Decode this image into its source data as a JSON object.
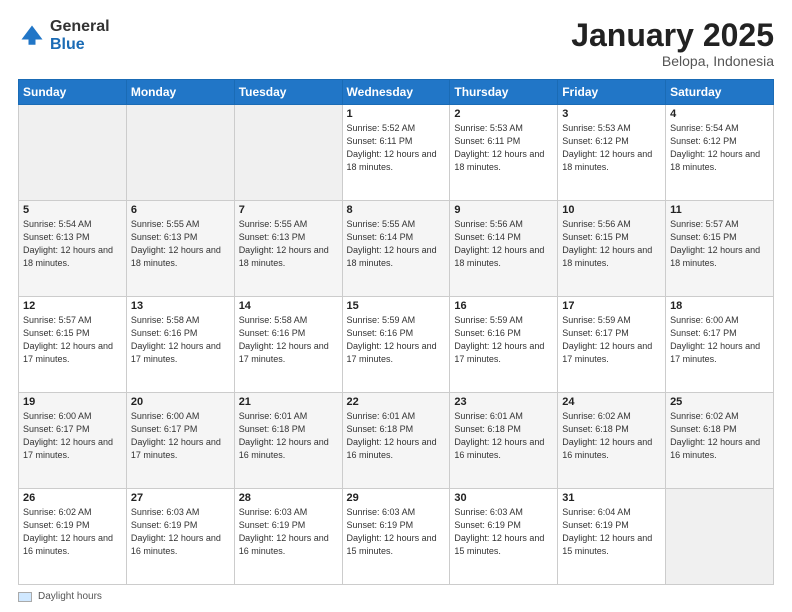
{
  "logo": {
    "general": "General",
    "blue": "Blue"
  },
  "title": "January 2025",
  "location": "Belopa, Indonesia",
  "days_header": [
    "Sunday",
    "Monday",
    "Tuesday",
    "Wednesday",
    "Thursday",
    "Friday",
    "Saturday"
  ],
  "footer_label": "Daylight hours",
  "weeks": [
    {
      "cells": [
        {
          "day": null,
          "info": null
        },
        {
          "day": null,
          "info": null
        },
        {
          "day": null,
          "info": null
        },
        {
          "day": "1",
          "info": "Sunrise: 5:52 AM\nSunset: 6:11 PM\nDaylight: 12 hours\nand 18 minutes."
        },
        {
          "day": "2",
          "info": "Sunrise: 5:53 AM\nSunset: 6:11 PM\nDaylight: 12 hours\nand 18 minutes."
        },
        {
          "day": "3",
          "info": "Sunrise: 5:53 AM\nSunset: 6:12 PM\nDaylight: 12 hours\nand 18 minutes."
        },
        {
          "day": "4",
          "info": "Sunrise: 5:54 AM\nSunset: 6:12 PM\nDaylight: 12 hours\nand 18 minutes."
        }
      ]
    },
    {
      "cells": [
        {
          "day": "5",
          "info": "Sunrise: 5:54 AM\nSunset: 6:13 PM\nDaylight: 12 hours\nand 18 minutes."
        },
        {
          "day": "6",
          "info": "Sunrise: 5:55 AM\nSunset: 6:13 PM\nDaylight: 12 hours\nand 18 minutes."
        },
        {
          "day": "7",
          "info": "Sunrise: 5:55 AM\nSunset: 6:13 PM\nDaylight: 12 hours\nand 18 minutes."
        },
        {
          "day": "8",
          "info": "Sunrise: 5:55 AM\nSunset: 6:14 PM\nDaylight: 12 hours\nand 18 minutes."
        },
        {
          "day": "9",
          "info": "Sunrise: 5:56 AM\nSunset: 6:14 PM\nDaylight: 12 hours\nand 18 minutes."
        },
        {
          "day": "10",
          "info": "Sunrise: 5:56 AM\nSunset: 6:15 PM\nDaylight: 12 hours\nand 18 minutes."
        },
        {
          "day": "11",
          "info": "Sunrise: 5:57 AM\nSunset: 6:15 PM\nDaylight: 12 hours\nand 18 minutes."
        }
      ]
    },
    {
      "cells": [
        {
          "day": "12",
          "info": "Sunrise: 5:57 AM\nSunset: 6:15 PM\nDaylight: 12 hours\nand 17 minutes."
        },
        {
          "day": "13",
          "info": "Sunrise: 5:58 AM\nSunset: 6:16 PM\nDaylight: 12 hours\nand 17 minutes."
        },
        {
          "day": "14",
          "info": "Sunrise: 5:58 AM\nSunset: 6:16 PM\nDaylight: 12 hours\nand 17 minutes."
        },
        {
          "day": "15",
          "info": "Sunrise: 5:59 AM\nSunset: 6:16 PM\nDaylight: 12 hours\nand 17 minutes."
        },
        {
          "day": "16",
          "info": "Sunrise: 5:59 AM\nSunset: 6:16 PM\nDaylight: 12 hours\nand 17 minutes."
        },
        {
          "day": "17",
          "info": "Sunrise: 5:59 AM\nSunset: 6:17 PM\nDaylight: 12 hours\nand 17 minutes."
        },
        {
          "day": "18",
          "info": "Sunrise: 6:00 AM\nSunset: 6:17 PM\nDaylight: 12 hours\nand 17 minutes."
        }
      ]
    },
    {
      "cells": [
        {
          "day": "19",
          "info": "Sunrise: 6:00 AM\nSunset: 6:17 PM\nDaylight: 12 hours\nand 17 minutes."
        },
        {
          "day": "20",
          "info": "Sunrise: 6:00 AM\nSunset: 6:17 PM\nDaylight: 12 hours\nand 17 minutes."
        },
        {
          "day": "21",
          "info": "Sunrise: 6:01 AM\nSunset: 6:18 PM\nDaylight: 12 hours\nand 16 minutes."
        },
        {
          "day": "22",
          "info": "Sunrise: 6:01 AM\nSunset: 6:18 PM\nDaylight: 12 hours\nand 16 minutes."
        },
        {
          "day": "23",
          "info": "Sunrise: 6:01 AM\nSunset: 6:18 PM\nDaylight: 12 hours\nand 16 minutes."
        },
        {
          "day": "24",
          "info": "Sunrise: 6:02 AM\nSunset: 6:18 PM\nDaylight: 12 hours\nand 16 minutes."
        },
        {
          "day": "25",
          "info": "Sunrise: 6:02 AM\nSunset: 6:18 PM\nDaylight: 12 hours\nand 16 minutes."
        }
      ]
    },
    {
      "cells": [
        {
          "day": "26",
          "info": "Sunrise: 6:02 AM\nSunset: 6:19 PM\nDaylight: 12 hours\nand 16 minutes."
        },
        {
          "day": "27",
          "info": "Sunrise: 6:03 AM\nSunset: 6:19 PM\nDaylight: 12 hours\nand 16 minutes."
        },
        {
          "day": "28",
          "info": "Sunrise: 6:03 AM\nSunset: 6:19 PM\nDaylight: 12 hours\nand 16 minutes."
        },
        {
          "day": "29",
          "info": "Sunrise: 6:03 AM\nSunset: 6:19 PM\nDaylight: 12 hours\nand 15 minutes."
        },
        {
          "day": "30",
          "info": "Sunrise: 6:03 AM\nSunset: 6:19 PM\nDaylight: 12 hours\nand 15 minutes."
        },
        {
          "day": "31",
          "info": "Sunrise: 6:04 AM\nSunset: 6:19 PM\nDaylight: 12 hours\nand 15 minutes."
        },
        {
          "day": null,
          "info": null
        }
      ]
    }
  ]
}
